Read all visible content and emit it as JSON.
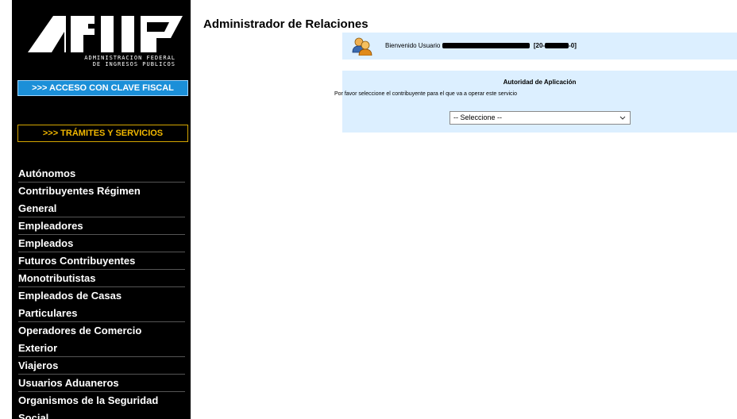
{
  "logo": {
    "line1": "ADMINISTRACION FEDERAL",
    "line2": "DE INGRESOS PUBLICOS"
  },
  "buttons": {
    "clave_fiscal": ">>> ACCESO CON CLAVE FISCAL",
    "tramites": ">>> TRÁMITES Y SERVICIOS"
  },
  "menu": [
    "Autónomos",
    "Contribuyentes Régimen",
    "General",
    "Empleadores",
    "Empleados",
    "Futuros Contribuyentes",
    "Monotributistas",
    "Empleados de Casas",
    "Particulares",
    "Operadores de Comercio",
    "Exterior",
    "Viajeros",
    "Usuarios Aduaneros",
    "Organismos de la Seguridad",
    "Social"
  ],
  "main": {
    "title": "Administrador de Relaciones",
    "welcome_prefix": "Bienvenido Usuario",
    "cuit_prefix": "[20-",
    "cuit_suffix": "-0]",
    "panel_title": "Autoridad de Aplicación",
    "instruction": "Por favor seleccione el contribuyente para el que va a operar este servicio",
    "select_value": "-- Seleccione --"
  },
  "colors": {
    "sidebar_bg": "#000000",
    "clave_button": "#1b8fd8",
    "tramites_text": "#f2b800",
    "panel_bg": "#dcefff"
  },
  "icons": [
    "afip-logo",
    "users-icon",
    "chevron-down-icon"
  ]
}
